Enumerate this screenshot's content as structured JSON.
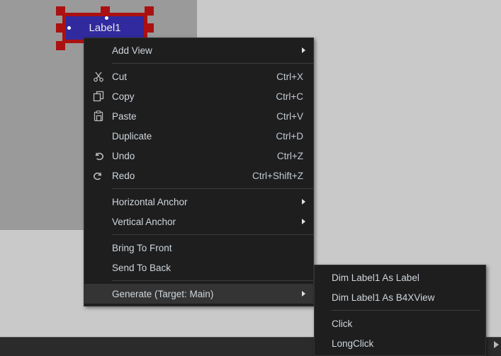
{
  "canvas": {
    "widget": {
      "name": "label-widget",
      "text": "Label1",
      "fill_color": "#312a9e",
      "selection_color": "#ab1111"
    }
  },
  "context_menu": {
    "name": "designer-context-menu",
    "items": [
      {
        "label": "Add View",
        "shortcut": "",
        "icon": "",
        "submenu": true,
        "separator_after": true,
        "highlighted": false
      },
      {
        "label": "Cut",
        "shortcut": "Ctrl+X",
        "icon": "scissors-icon",
        "submenu": false,
        "separator_after": false,
        "highlighted": false
      },
      {
        "label": "Copy",
        "shortcut": "Ctrl+C",
        "icon": "copy-icon",
        "submenu": false,
        "separator_after": false,
        "highlighted": false
      },
      {
        "label": "Paste",
        "shortcut": "Ctrl+V",
        "icon": "paste-icon",
        "submenu": false,
        "separator_after": false,
        "highlighted": false
      },
      {
        "label": "Duplicate",
        "shortcut": "Ctrl+D",
        "icon": "",
        "submenu": false,
        "separator_after": false,
        "highlighted": false
      },
      {
        "label": "Undo",
        "shortcut": "Ctrl+Z",
        "icon": "undo-icon",
        "submenu": false,
        "separator_after": false,
        "highlighted": false
      },
      {
        "label": "Redo",
        "shortcut": "Ctrl+Shift+Z",
        "icon": "redo-icon",
        "submenu": false,
        "separator_after": true,
        "highlighted": false
      },
      {
        "label": "Horizontal Anchor",
        "shortcut": "",
        "icon": "",
        "submenu": true,
        "separator_after": false,
        "highlighted": false
      },
      {
        "label": "Vertical Anchor",
        "shortcut": "",
        "icon": "",
        "submenu": true,
        "separator_after": true,
        "highlighted": false
      },
      {
        "label": "Bring To Front",
        "shortcut": "",
        "icon": "",
        "submenu": false,
        "separator_after": false,
        "highlighted": false
      },
      {
        "label": "Send To Back",
        "shortcut": "",
        "icon": "",
        "submenu": false,
        "separator_after": true,
        "highlighted": false
      },
      {
        "label": "Generate (Target: Main)",
        "shortcut": "",
        "icon": "",
        "submenu": true,
        "separator_after": false,
        "highlighted": true
      }
    ]
  },
  "generate_submenu": {
    "name": "generate-submenu",
    "items": [
      {
        "label": "Dim Label1 As Label",
        "separator_after": false
      },
      {
        "label": "Dim Label1 As B4XView",
        "separator_after": true
      },
      {
        "label": "Click",
        "separator_after": false
      },
      {
        "label": "LongClick",
        "separator_after": false
      }
    ]
  },
  "colors": {
    "menu_background": "#1e1e1e",
    "menu_highlight": "#343434",
    "menu_text": "#cfd6dd",
    "canvas_background": "#9a9a9a",
    "panel_background": "#c9c9c9",
    "bottom_bar": "#2b2b2b"
  }
}
